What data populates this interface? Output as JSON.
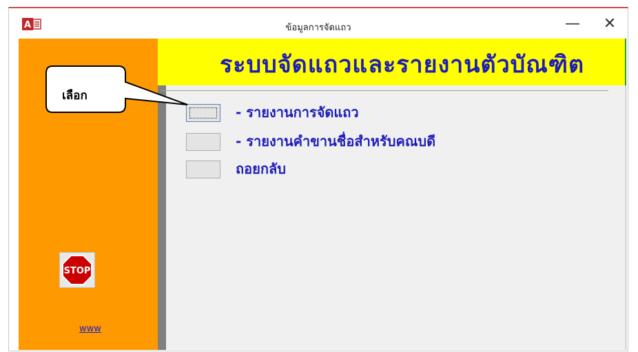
{
  "window": {
    "title": "ข้อมูลการจัดแถว",
    "app_icon": "access-icon",
    "minimize": "—",
    "close": "✕"
  },
  "banner": {
    "text": "ระบบจัดแถวและรายงานตัวบัณฑิต"
  },
  "callout": {
    "text": "เลือก"
  },
  "options": [
    {
      "label": "- รายงานการจัดแถว",
      "focused": true
    },
    {
      "label": "- รายงานคำขานชื่อสำหรับคณบดี",
      "focused": false
    },
    {
      "label": "ถอยกลับ",
      "focused": false
    }
  ],
  "sidebar": {
    "stop_label": "STOP",
    "link": "www"
  },
  "colors": {
    "orange": "#ff9900",
    "banner_bg": "#ffff00",
    "banner_text": "#1d1db8",
    "stop_red": "#cc0000"
  }
}
